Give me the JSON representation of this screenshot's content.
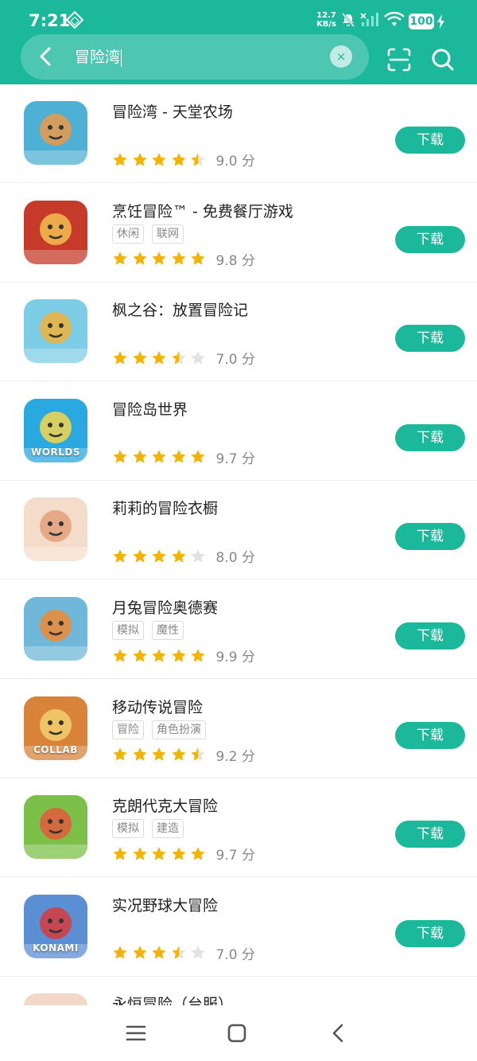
{
  "status": {
    "time": "7:21",
    "speed_value": "12.7",
    "speed_unit": "KB/s",
    "battery": "100"
  },
  "search": {
    "query": "冒险湾",
    "clear_glyph": "×"
  },
  "icons": {
    "back": "chevron-left-icon",
    "clear": "close-icon",
    "scan": "scan-icon",
    "search": "search-icon",
    "nav_menu": "menu-icon",
    "nav_home": "home-icon",
    "nav_back": "back-icon"
  },
  "colors": {
    "brand": "#1cb89b",
    "star": "#f5b301",
    "star_empty": "#e2e2e2",
    "text": "#222222",
    "muted": "#888888"
  },
  "download_label": "下载",
  "score_unit": "分",
  "apps": [
    {
      "name": "冒险湾 - 天堂农场",
      "tags": [],
      "rating": 4.5,
      "score": "9.0"
    },
    {
      "name": "烹饪冒险™ - 免费餐厅游戏",
      "tags": [
        "休闲",
        "联网"
      ],
      "rating": 5,
      "score": "9.8"
    },
    {
      "name": "枫之谷：放置冒险记",
      "tags": [],
      "rating": 3.5,
      "score": "7.0"
    },
    {
      "name": "冒险岛世界",
      "tags": [],
      "rating": 5,
      "score": "9.7"
    },
    {
      "name": "莉莉的冒险衣橱",
      "tags": [],
      "rating": 4,
      "score": "8.0"
    },
    {
      "name": "月兔冒险奥德赛",
      "tags": [
        "模拟",
        "魔性"
      ],
      "rating": 5,
      "score": "9.9"
    },
    {
      "name": "移动传说冒险",
      "tags": [
        "冒险",
        "角色扮演"
      ],
      "rating": 4.5,
      "score": "9.2"
    },
    {
      "name": "克朗代克大冒险",
      "tags": [
        "模拟",
        "建造"
      ],
      "rating": 5,
      "score": "9.7"
    },
    {
      "name": "实况野球大冒险",
      "tags": [],
      "rating": 3.5,
      "score": "7.0"
    },
    {
      "name": "永恒冒险（台服）",
      "tags": [],
      "rating": null,
      "score": null
    }
  ],
  "icon_art": [
    {
      "bg": "#4fb0d6",
      "accent": "#e99a4a",
      "label": ""
    },
    {
      "bg": "#c63a2a",
      "accent": "#f2c04d",
      "label": ""
    },
    {
      "bg": "#7ecde6",
      "accent": "#f0b23a",
      "label": ""
    },
    {
      "bg": "#2aa8e0",
      "accent": "#f6d64a",
      "label": "WORLDS"
    },
    {
      "bg": "#f4dccb",
      "accent": "#e3a07b",
      "label": ""
    },
    {
      "bg": "#6fb8d9",
      "accent": "#ef8a33",
      "label": ""
    },
    {
      "bg": "#d9833a",
      "accent": "#f1d06d",
      "label": "COLLAB"
    },
    {
      "bg": "#7cc04a",
      "accent": "#e35a3c",
      "label": ""
    },
    {
      "bg": "#5a8fd4",
      "accent": "#d93a3a",
      "label": "KONAMI"
    },
    {
      "bg": "#f3d8c7",
      "accent": "#e9b896",
      "label": ""
    }
  ]
}
